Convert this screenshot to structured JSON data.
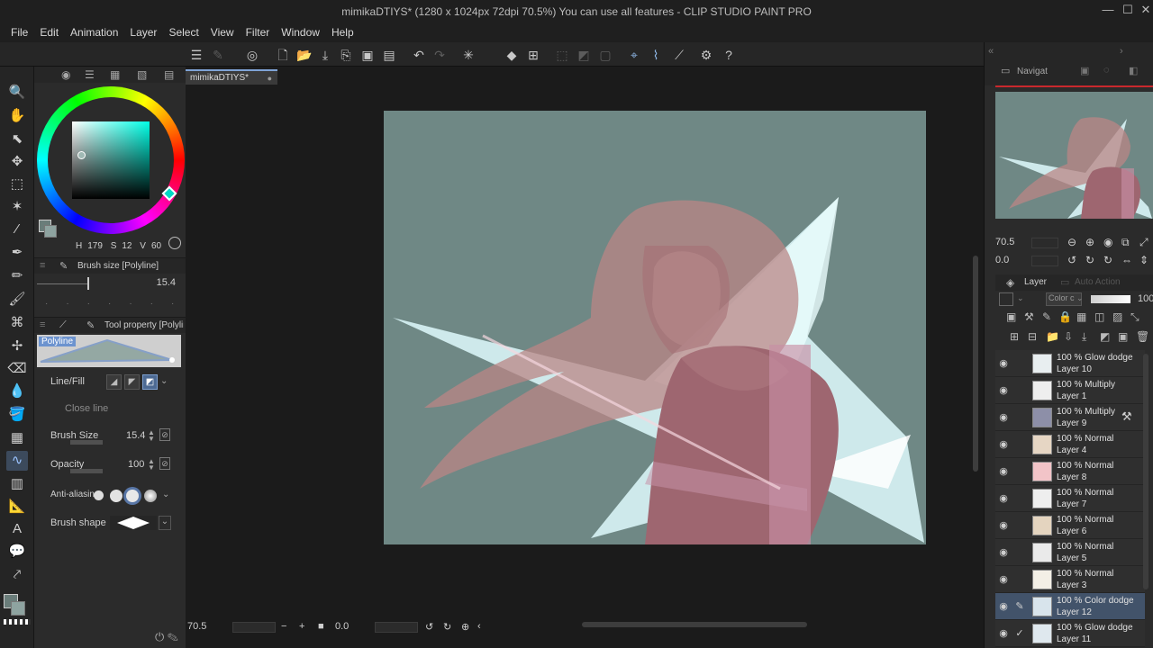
{
  "window": {
    "title": "mimikaDTIYS* (1280 x 1024px 72dpi 70.5%)  You can use all features - CLIP STUDIO PAINT PRO",
    "controls": [
      "—",
      "☐",
      "✕"
    ]
  },
  "menu": [
    "File",
    "Edit",
    "Animation",
    "Layer",
    "Select",
    "View",
    "Filter",
    "Window",
    "Help"
  ],
  "document_tab": {
    "label": "mimikaDTIYS*",
    "unsaved_dot": "●"
  },
  "color": {
    "foreground": "#6a7d7a",
    "background": "#8ea3a0",
    "h_label": "H",
    "h": "179",
    "s_label": "S",
    "s": "12",
    "v_label": "V",
    "v": "60"
  },
  "brush_size_panel": {
    "title": "Brush size [Polyline]",
    "value": "15.4"
  },
  "tool_property_panel": {
    "title": "Tool property [Polyline]",
    "preview_label": "Polyline",
    "line_fill_label": "Line/Fill",
    "close_line_label": "Close line",
    "brush_size_label": "Brush Size",
    "brush_size_value": "15.4",
    "opacity_label": "Opacity",
    "opacity_value": "100",
    "antialias_label": "Anti-aliasing",
    "brush_shape_label": "Brush shape"
  },
  "status": {
    "zoom": "70.5",
    "rotation": "0.0"
  },
  "navigator": {
    "tab_label": "Navigat",
    "zoom": "70.5",
    "rotation": "0.0"
  },
  "layer_panel": {
    "tab_label": "Layer",
    "auto_action_label": "Auto Action",
    "blend_mode": "Color c",
    "opacity": "100",
    "layers": [
      {
        "mode": "100 % Glow dodge",
        "name": "Layer 10",
        "thumb": "#e8eef0",
        "selected": false,
        "editing": false,
        "reference": false
      },
      {
        "mode": "100 % Multiply",
        "name": "Layer 1",
        "thumb": "#eeeeee",
        "selected": false,
        "editing": false,
        "reference": false
      },
      {
        "mode": "100 % Multiply",
        "name": "Layer 9",
        "thumb": "#8d8fa8",
        "selected": false,
        "editing": false,
        "reference": true
      },
      {
        "mode": "100 % Normal",
        "name": "Layer 4",
        "thumb": "#e6d6c4",
        "selected": false,
        "editing": false,
        "reference": false
      },
      {
        "mode": "100 % Normal",
        "name": "Layer 8",
        "thumb": "#f2c4c8",
        "selected": false,
        "editing": false,
        "reference": false
      },
      {
        "mode": "100 % Normal",
        "name": "Layer 7",
        "thumb": "#eeeeee",
        "selected": false,
        "editing": false,
        "reference": false
      },
      {
        "mode": "100 % Normal",
        "name": "Layer 6",
        "thumb": "#e4d4bf",
        "selected": false,
        "editing": false,
        "reference": false
      },
      {
        "mode": "100 % Normal",
        "name": "Layer 5",
        "thumb": "#eaeaea",
        "selected": false,
        "editing": false,
        "reference": false
      },
      {
        "mode": "100 % Normal",
        "name": "Layer 3",
        "thumb": "#f3efe6",
        "selected": false,
        "editing": false,
        "reference": false
      },
      {
        "mode": "100 % Color dodge",
        "name": "Layer 12",
        "thumb": "#d8e4ec",
        "selected": true,
        "editing": true,
        "reference": false
      },
      {
        "mode": "100 % Glow dodge",
        "name": "Layer 11",
        "thumb": "#dfe8ee",
        "selected": false,
        "editing": false,
        "reference": false
      }
    ]
  }
}
